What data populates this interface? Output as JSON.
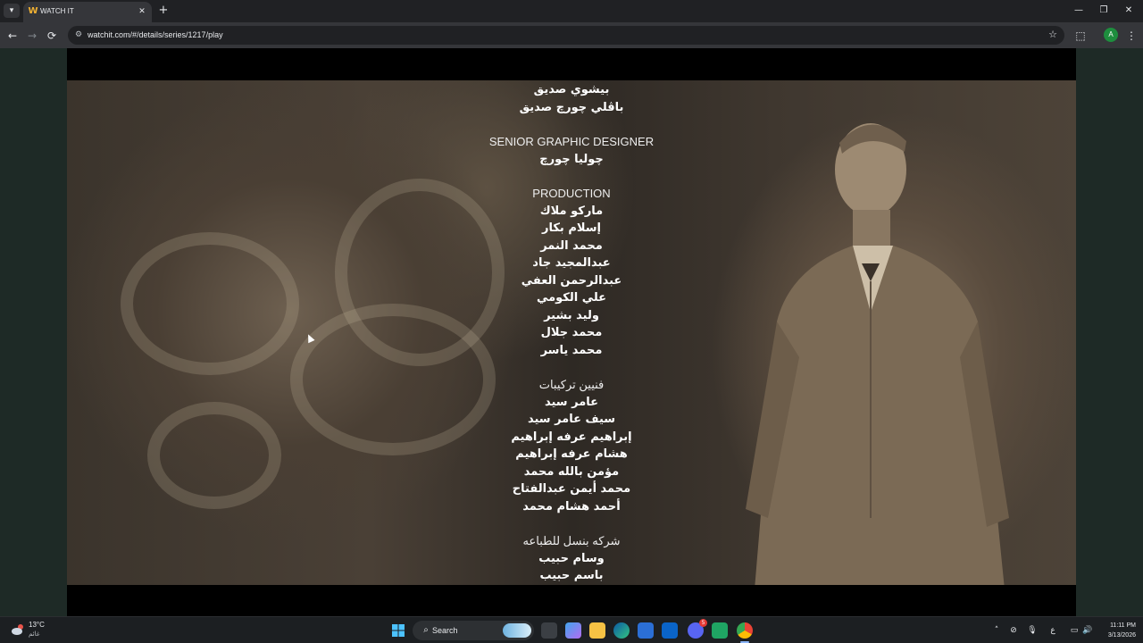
{
  "browser": {
    "tab_title": "WATCH IT",
    "tab_favicon": "W",
    "url": "watchit.com/#/details/series/1217/play",
    "profile_initial": "A",
    "icons": {
      "tab_menu": "▾",
      "close": "✕",
      "new_tab": "+",
      "minimize": "—",
      "restore": "❐",
      "window_close": "✕",
      "back": "←",
      "forward": "→",
      "reload": "⟳",
      "site_info": "⚙",
      "star": "☆",
      "extensions": "⬚",
      "menu": "⋮"
    }
  },
  "credits": [
    {
      "type": "name",
      "text": "بيشوي صديق"
    },
    {
      "type": "name",
      "text": "باڤلي چورچ صديق"
    },
    {
      "type": "heading",
      "text": "SENIOR GRAPHIC DESIGNER"
    },
    {
      "type": "name",
      "text": "چوليا چورچ"
    },
    {
      "type": "heading",
      "text": "PRODUCTION"
    },
    {
      "type": "name",
      "text": "ماركو ملاك"
    },
    {
      "type": "name",
      "text": "إسلام بكار"
    },
    {
      "type": "name",
      "text": "محمد النمر"
    },
    {
      "type": "name",
      "text": "عبدالمجيد جاد"
    },
    {
      "type": "name",
      "text": "عبدالرحمن العفي"
    },
    {
      "type": "name",
      "text": "علي الكومي"
    },
    {
      "type": "name",
      "text": "وليد بشير"
    },
    {
      "type": "name",
      "text": "محمد جلال"
    },
    {
      "type": "name",
      "text": "محمد ياسر"
    },
    {
      "type": "heading",
      "text": "فنيين تركيبات"
    },
    {
      "type": "name",
      "text": "عامر سيد"
    },
    {
      "type": "name",
      "text": "سيف عامر سيد"
    },
    {
      "type": "name",
      "text": "إبراهيم عرفه إبراهيم"
    },
    {
      "type": "name",
      "text": "هشام عرفه إبراهيم"
    },
    {
      "type": "name",
      "text": "مؤمن بالله محمد"
    },
    {
      "type": "name",
      "text": "محمد أيمن عبدالفتاح"
    },
    {
      "type": "name",
      "text": "أحمد هشام محمد"
    },
    {
      "type": "heading",
      "text": "شركه بنسل للطباعه"
    },
    {
      "type": "name",
      "text": "وسام حبيب"
    },
    {
      "type": "name",
      "text": "باسم حبيب"
    }
  ],
  "taskbar": {
    "weather_temp": "13°C",
    "weather_desc": "غائم",
    "search_label": "Search",
    "search_icon": "⌕",
    "lang": "ع",
    "time": "11:11 PM",
    "date": "3/13/2026",
    "discord_badge": "5",
    "tray_icons": {
      "chevron": "˄",
      "network_off": "⊘",
      "mic": "🎙",
      "display": "▭",
      "volume": "🔊"
    }
  },
  "colors": {
    "accent": "#8ab4f8",
    "chrome_dark": "#202124",
    "chrome_toolbar": "#35363a",
    "credits_text": "#ffffff"
  }
}
